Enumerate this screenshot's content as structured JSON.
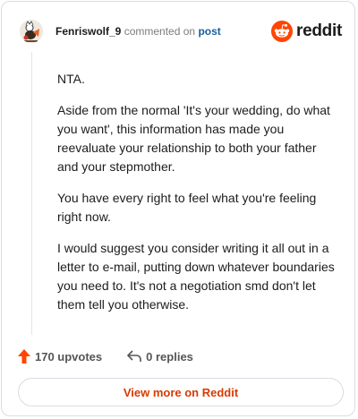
{
  "header": {
    "username": "Fenriswolf_9",
    "action_text": "commented on",
    "target_link": "post",
    "logo_text": "reddit",
    "avatar_icon": "fenrir-avatar-icon",
    "logo_icon": "reddit-snoo-icon"
  },
  "comment": {
    "paragraphs": [
      "NTA.",
      "Aside from the normal 'It's your wedding, do what you want', this information has made you reevaluate your relationship to both your father and your stepmother.",
      "You have every right to feel what you're feeling right now.",
      "I would suggest you consider writing it all out in a letter to e-mail, putting down whatever boundaries you need to. It's not a negotiation smd don't let them tell you otherwise."
    ]
  },
  "actions": {
    "upvotes_label": "170 upvotes",
    "replies_label": "0 replies",
    "upvote_icon": "upvote-arrow-icon",
    "reply_icon": "reply-arrow-icon"
  },
  "footer": {
    "view_more_label": "View more on Reddit"
  },
  "colors": {
    "brand": "#ff4500",
    "link": "#1a5f9e",
    "button_text": "#d93a00"
  }
}
